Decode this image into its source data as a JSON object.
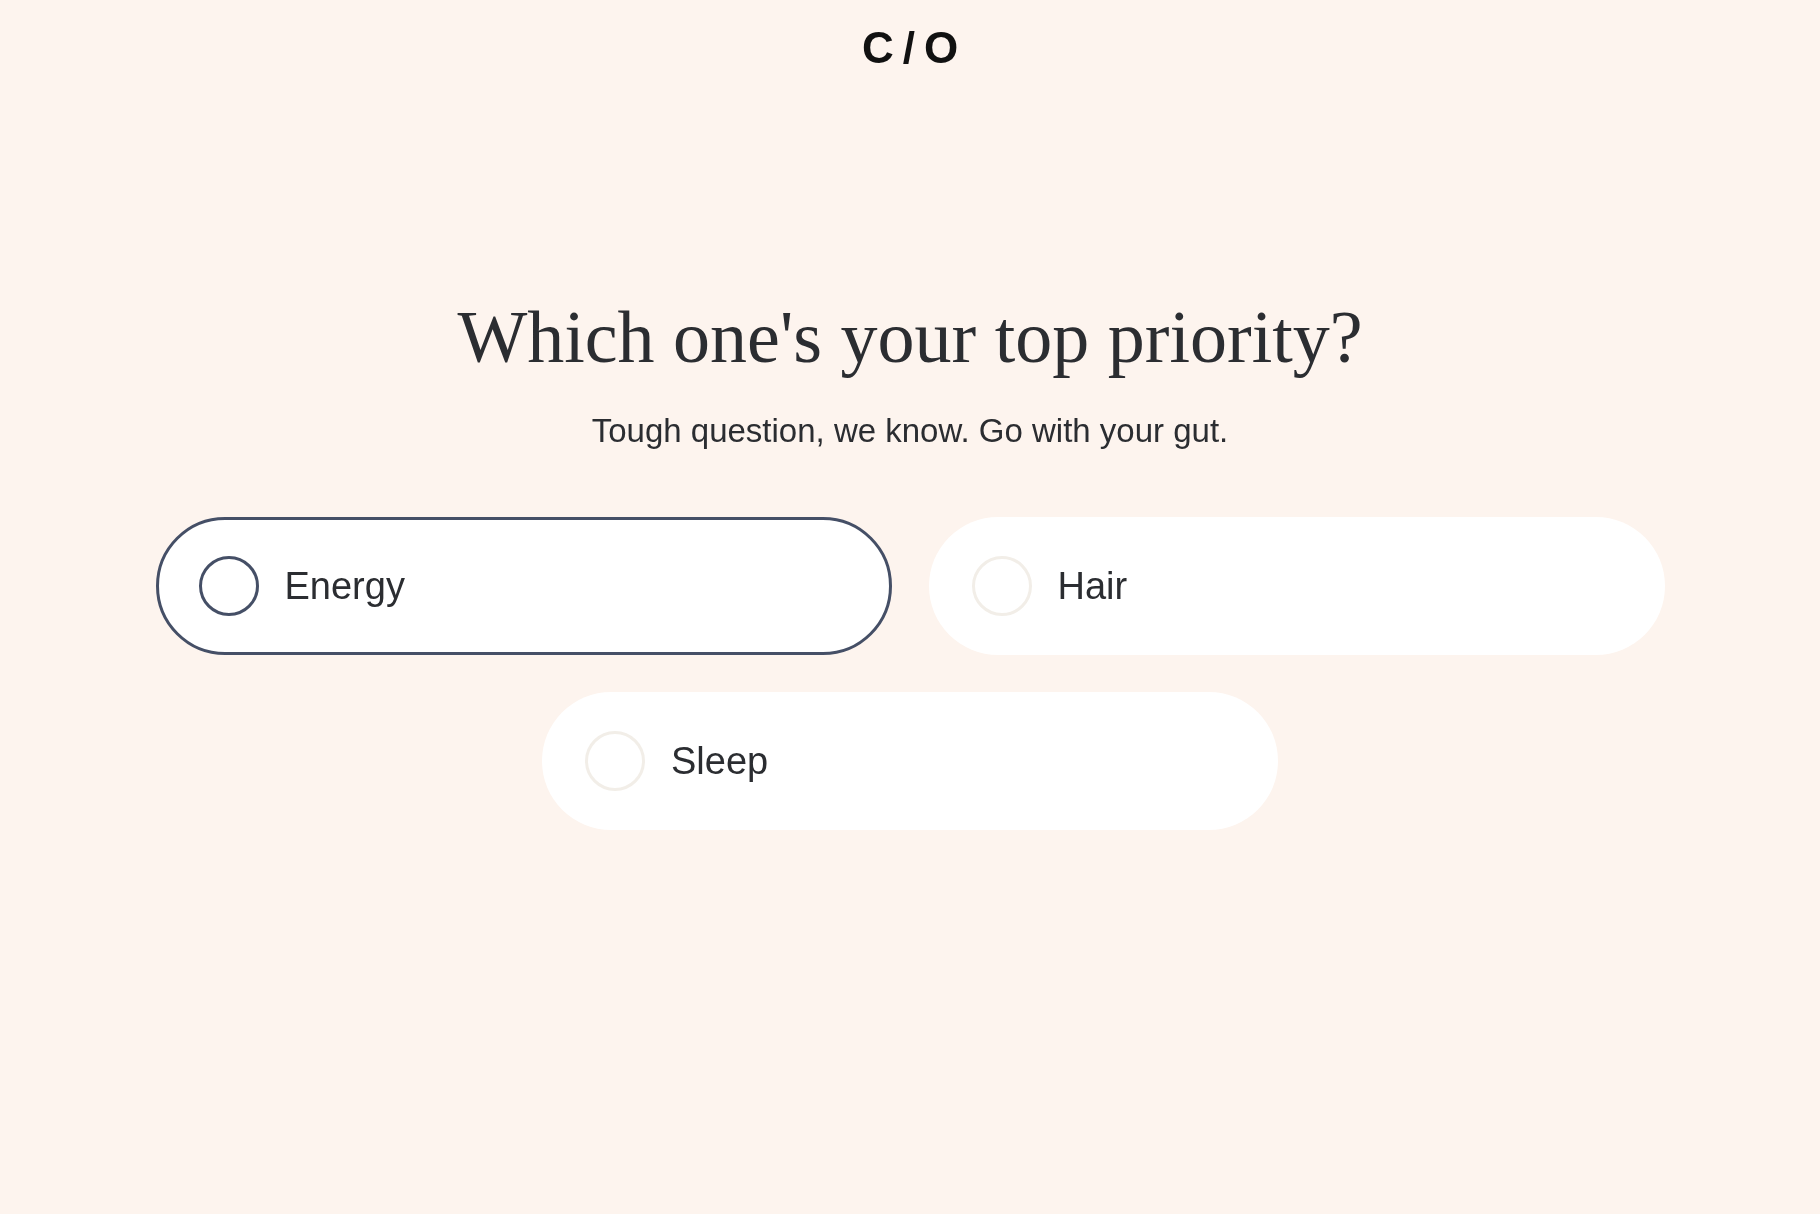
{
  "logo": "C/O",
  "question": {
    "title": "Which one's your top priority?",
    "subtitle": "Tough question, we know. Go with your gut."
  },
  "options": [
    {
      "label": "Energy",
      "hovered": true,
      "selected": false
    },
    {
      "label": "Hair",
      "hovered": false,
      "selected": false
    },
    {
      "label": "Sleep",
      "hovered": false,
      "selected": false
    }
  ]
}
